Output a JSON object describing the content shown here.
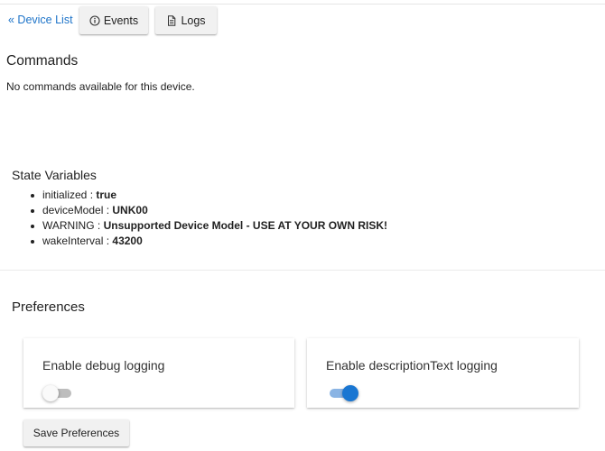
{
  "nav": {
    "device_list_label": "« Device List",
    "events_label": "Events",
    "events_icon": "info-icon",
    "logs_label": "Logs",
    "logs_icon": "document-icon"
  },
  "commands": {
    "title": "Commands",
    "empty_text": "No commands available for this device."
  },
  "state_variables": {
    "title": "State Variables",
    "items": [
      {
        "key": "initialized",
        "value": "true"
      },
      {
        "key": "deviceModel",
        "value": "UNK00"
      },
      {
        "key": "WARNING",
        "value": "Unsupported Device Model - USE AT YOUR OWN RISK!"
      },
      {
        "key": "wakeInterval",
        "value": "43200"
      }
    ],
    "separator": " : "
  },
  "preferences": {
    "title": "Preferences",
    "items": [
      {
        "label": "Enable debug logging",
        "enabled": false
      },
      {
        "label": "Enable descriptionText logging",
        "enabled": true
      }
    ],
    "save_label": "Save Preferences"
  },
  "colors": {
    "link": "#1e74c9",
    "toggle_on": "#1976d2",
    "toggle_on_track": "#8ab4e4",
    "toggle_off_track": "#bdbdbd"
  }
}
